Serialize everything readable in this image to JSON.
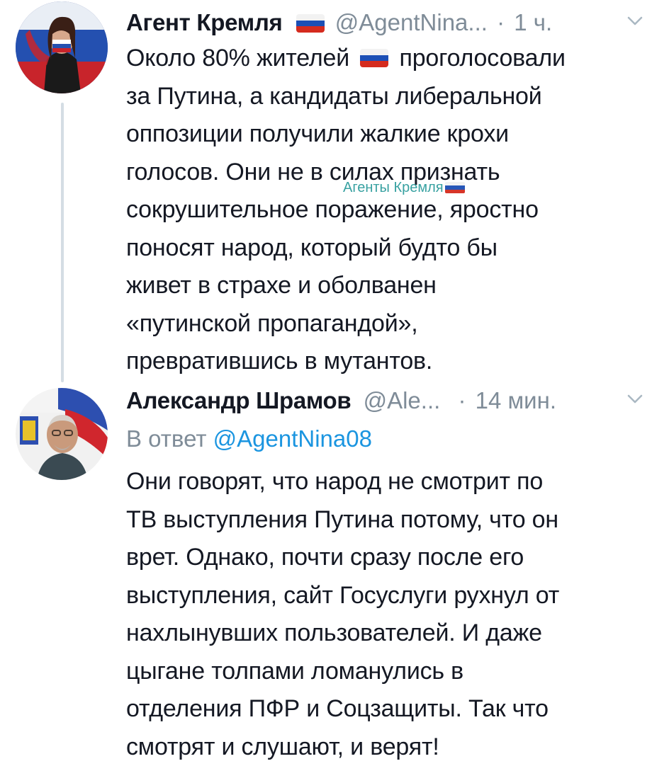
{
  "watermark": {
    "text": "Агенты Кремля"
  },
  "tweets": [
    {
      "author_name": "Агент Кремля",
      "handle": "@AgentNina...",
      "separator": "·",
      "time": "1 ч.",
      "body_lines": [
        [
          "Около 80% жителей ",
          "flag",
          " проголосовали"
        ],
        [
          "за Путина, а кандидаты либеральной"
        ],
        [
          "оппозиции получили жалкие крохи"
        ],
        [
          "голосов. Они не в силах признать"
        ],
        [
          "сокрушительное поражение, яростно"
        ],
        [
          "поносят народ, который будто бы"
        ],
        [
          "живет в страхе и оболванен"
        ],
        [
          "«путинской пропагандой»,"
        ],
        [
          "превратившись в мутантов."
        ]
      ],
      "icons": {
        "name_flag": "russia-flag-icon",
        "menu": "chevron-down-icon"
      }
    },
    {
      "author_name": "Александр Шрамов",
      "handle": "@Ale...",
      "separator": "·",
      "time": "14 мин.",
      "reply_prefix": "В ответ",
      "reply_mention": "@AgentNina08",
      "body_lines": [
        [
          "Они говорят, что народ не смотрит по"
        ],
        [
          "ТВ выступления Путина потому, что он"
        ],
        [
          "врет. Однако, почти сразу после его"
        ],
        [
          "выступления, сайт Госуслуги рухнул от"
        ],
        [
          "нахлынувших пользователей. И даже"
        ],
        [
          "цыгане толпами ломанулись в"
        ],
        [
          "отделения ПФР и Соцзащиты. Так что"
        ],
        [
          "смотрят и слушают, и верят!"
        ]
      ],
      "icons": {
        "menu": "chevron-down-icon"
      }
    }
  ],
  "colors": {
    "text": "#141823",
    "secondary": "#7f8c98",
    "link": "#1b95e0",
    "watermark": "#2e9c9c",
    "thread_line": "#d4dde4"
  }
}
